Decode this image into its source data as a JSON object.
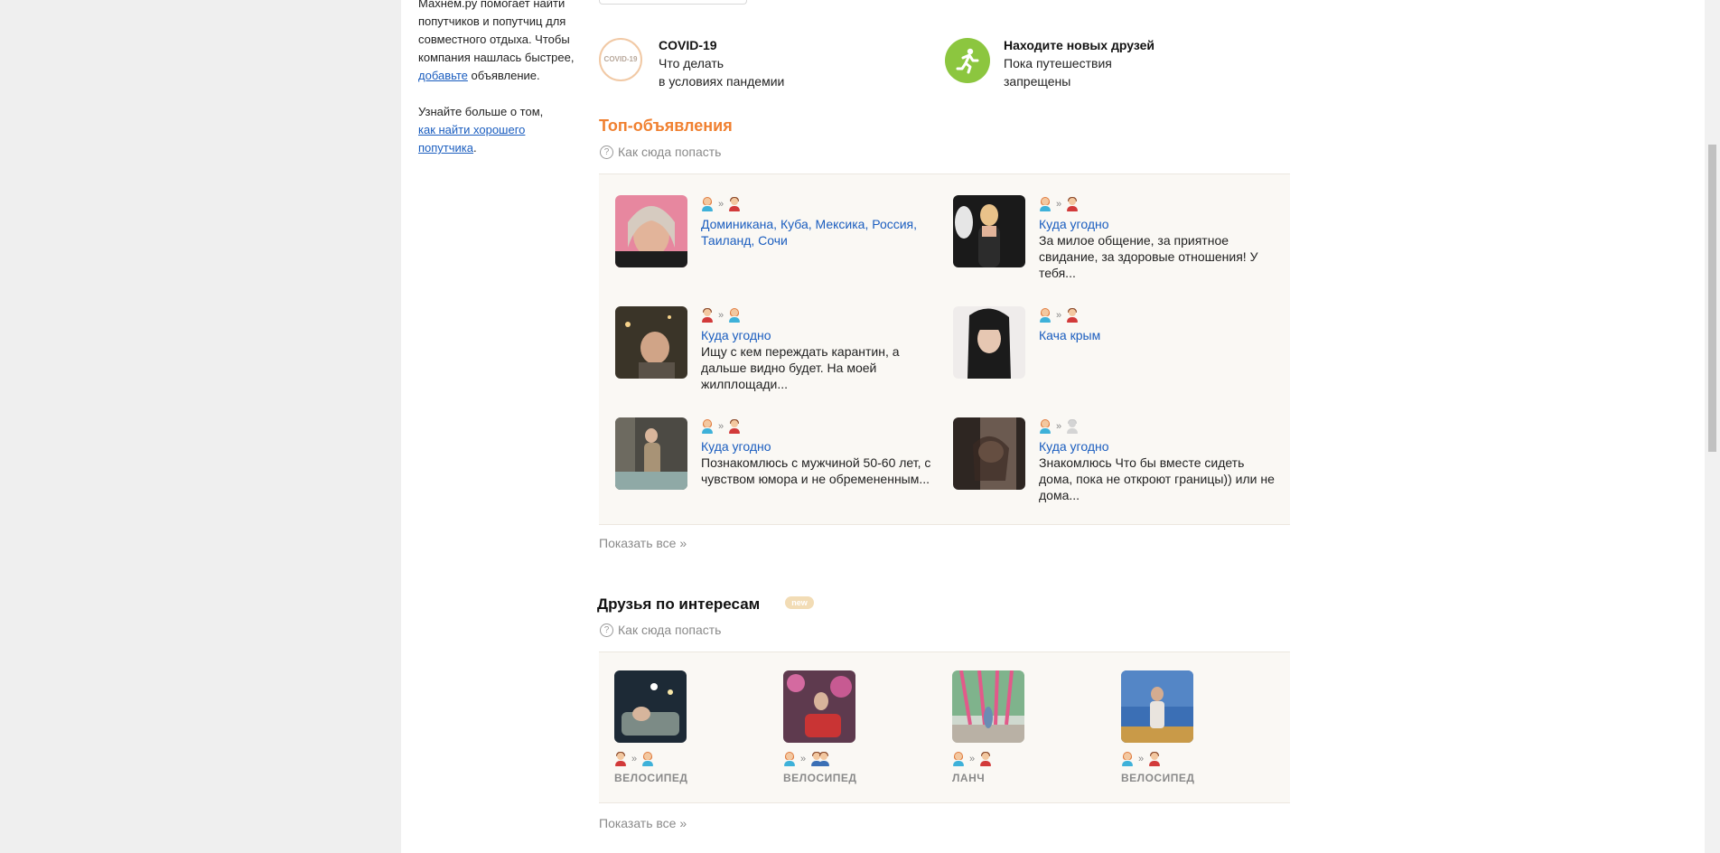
{
  "sidebar": {
    "intro_lines": [
      "Махнём.ру помогает найти",
      "попутчиков и попутчиц для",
      "совместного отдыха. Чтобы",
      "компания нашлась быстрее,"
    ],
    "add_link": "добавьте",
    "add_suffix": " объявление.",
    "learn_line": "Узнайте больше о том,",
    "learn_link_1": "как найти хорошего",
    "learn_link_2": "попутчика",
    "learn_suffix": "."
  },
  "info_cards": {
    "covid": {
      "logo_text": "COVID-19",
      "title": "COVID-19",
      "line1": "Что делать",
      "line2": "в условиях пандемии"
    },
    "friends": {
      "icon": "running-man-icon",
      "title": "Находите новых друзей",
      "line1": "Пока путешествия",
      "line2": "запрещены"
    }
  },
  "top_ads": {
    "title": "Топ-объявления",
    "howto": "Как сюда попасть",
    "show_all": "Показать все »",
    "cards": [
      {
        "from": "f",
        "to": "m",
        "dest": "Доминикана, Куба, Мексика, Россия, Таиланд, Сочи",
        "text": ""
      },
      {
        "from": "f",
        "to": "m",
        "dest": "Куда угодно",
        "text": "За милое общение, за приятное свидание, за здоровые отношения! У тебя..."
      },
      {
        "from": "m",
        "to": "f",
        "dest": "Куда угодно",
        "text": "Ищу с кем переждать карантин, а дальше видно будет. На моей жилплощади..."
      },
      {
        "from": "f",
        "to": "m",
        "dest": "Кача крым",
        "text": ""
      },
      {
        "from": "f",
        "to": "m",
        "dest": "Куда угодно",
        "text": "Познакомлюсь с мужчиной 50-60 лет, с чувством юмора и не обремененным..."
      },
      {
        "from": "f",
        "to": "g",
        "dest": "Куда угодно",
        "text": "Знакомлюсь Что бы вместе сидеть дома, пока не откроют границы)) или не дома..."
      }
    ]
  },
  "friends_by_interests": {
    "title": "Друзья по интересам",
    "badge": "new",
    "howto": "Как сюда попасть",
    "show_all": "Показать все »",
    "items": [
      {
        "from": "m",
        "to": "f",
        "interest": "ВЕЛОСИПЕД"
      },
      {
        "from": "f",
        "to": "mm",
        "interest": "ВЕЛОСИПЕД"
      },
      {
        "from": "f",
        "to": "m",
        "interest": "ЛАНЧ"
      },
      {
        "from": "f",
        "to": "m",
        "interest": "ВЕЛОСИПЕД"
      }
    ]
  },
  "colors": {
    "accent_orange": "#f08030",
    "link_blue": "#1a5dbf",
    "green": "#8cc63f"
  }
}
